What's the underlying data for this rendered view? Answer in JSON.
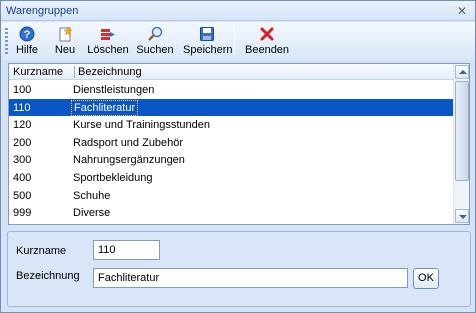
{
  "window": {
    "title": "Warengruppen"
  },
  "toolbar": {
    "items": [
      {
        "label": "Hilfe",
        "icon": "help-icon"
      },
      {
        "label": "Neu",
        "icon": "new-icon"
      },
      {
        "label": "Löschen",
        "icon": "delete-icon"
      },
      {
        "label": "Suchen",
        "icon": "search-icon"
      },
      {
        "label": "Speichern",
        "icon": "save-icon"
      },
      {
        "label": "Beenden",
        "icon": "close-icon"
      }
    ]
  },
  "grid": {
    "columns": [
      "Kurzname",
      "Bezeichnung"
    ],
    "rows": [
      {
        "kurzname": "100",
        "bezeichnung": "Dienstleistungen",
        "selected": false
      },
      {
        "kurzname": "110",
        "bezeichnung": "Fachliteratur",
        "selected": true
      },
      {
        "kurzname": "120",
        "bezeichnung": "Kurse und Trainingsstunden",
        "selected": false
      },
      {
        "kurzname": "200",
        "bezeichnung": "Radsport und Zubehör",
        "selected": false
      },
      {
        "kurzname": "300",
        "bezeichnung": "Nahrungsergänzungen",
        "selected": false
      },
      {
        "kurzname": "400",
        "bezeichnung": "Sportbekleidung",
        "selected": false
      },
      {
        "kurzname": "500",
        "bezeichnung": "Schuhe",
        "selected": false
      },
      {
        "kurzname": "999",
        "bezeichnung": "Diverse",
        "selected": false
      }
    ]
  },
  "form": {
    "kurzname_label": "Kurzname",
    "kurzname_value": "110",
    "bezeichnung_label": "Bezeichnung",
    "bezeichnung_value": "Fachliteratur",
    "ok_label": "OK"
  },
  "colors": {
    "selection": "#0a56c7",
    "title_text": "#15428b",
    "panel_bg": "#d4e3f6"
  }
}
